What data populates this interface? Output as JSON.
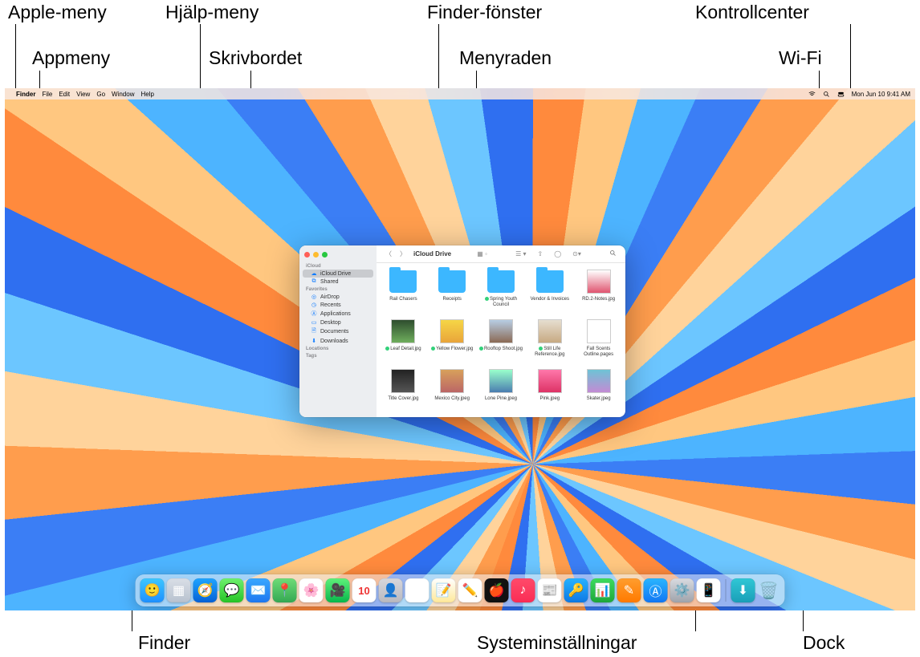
{
  "callouts": {
    "apple_menu": "Apple-meny",
    "app_menu": "Appmeny",
    "help_menu": "Hjälp-meny",
    "desktop": "Skrivbordet",
    "finder_window": "Finder-fönster",
    "menubar": "Menyraden",
    "control_center": "Kontrollcenter",
    "wifi": "Wi-Fi",
    "finder": "Finder",
    "system_settings": "Systeminställningar",
    "dock": "Dock"
  },
  "menubar": {
    "app_name": "Finder",
    "items": [
      "File",
      "Edit",
      "View",
      "Go",
      "Window",
      "Help"
    ],
    "clock": "Mon Jun 10  9:41 AM"
  },
  "finder": {
    "title": "iCloud Drive",
    "sidebar": {
      "sections": [
        {
          "label": "iCloud",
          "items": [
            {
              "icon": "cloud",
              "label": "iCloud Drive",
              "selected": true
            },
            {
              "icon": "shared",
              "label": "Shared"
            }
          ]
        },
        {
          "label": "Favorites",
          "items": [
            {
              "icon": "airdrop",
              "label": "AirDrop"
            },
            {
              "icon": "clock",
              "label": "Recents"
            },
            {
              "icon": "apps",
              "label": "Applications"
            },
            {
              "icon": "desktop",
              "label": "Desktop"
            },
            {
              "icon": "doc",
              "label": "Documents"
            },
            {
              "icon": "download",
              "label": "Downloads"
            }
          ]
        },
        {
          "label": "Locations",
          "items": []
        },
        {
          "label": "Tags",
          "items": []
        }
      ]
    },
    "files": [
      {
        "type": "folder",
        "label": "Rail Chasers"
      },
      {
        "type": "folder",
        "label": "Receipts"
      },
      {
        "type": "folder",
        "label": "Spring Youth Council",
        "tag": true
      },
      {
        "type": "folder",
        "label": "Vendor & Invoices"
      },
      {
        "type": "image",
        "label": "RD.2-Notes.jpg",
        "bg": "linear-gradient(#fff,#e05570)"
      },
      {
        "type": "image",
        "label": "Leaf Detail.jpg",
        "tag": true,
        "bg": "linear-gradient(#2e4d2e,#6fae5d)"
      },
      {
        "type": "image",
        "label": "Yellow Flower.jpg",
        "tag": true,
        "bg": "linear-gradient(#f6d646,#e9a43a)"
      },
      {
        "type": "image",
        "label": "Rooftop Shoot.jpg",
        "tag": true,
        "bg": "linear-gradient(#b7cde4,#8b6a55)"
      },
      {
        "type": "image",
        "label": "Still Life Reference.jpg",
        "tag": true,
        "bg": "linear-gradient(#e6ded0,#c7a982)"
      },
      {
        "type": "image",
        "label": "Fall Scents Outline.pages",
        "bg": "#ffffff"
      },
      {
        "type": "image",
        "label": "Title Cover.jpg",
        "bg": "linear-gradient(#222,#555)"
      },
      {
        "type": "image",
        "label": "Mexico City.jpeg",
        "bg": "linear-gradient(#d8a05b,#b66)"
      },
      {
        "type": "image",
        "label": "Lone Pine.jpeg",
        "bg": "linear-gradient(#9fc,#4a7db0)"
      },
      {
        "type": "image",
        "label": "Pink.jpeg",
        "bg": "linear-gradient(#f7a,#d36)"
      },
      {
        "type": "image",
        "label": "Skater.jpeg",
        "bg": "linear-gradient(#6ec3d5,#c38bd4)"
      }
    ]
  },
  "dock": {
    "items": [
      {
        "name": "finder",
        "bg": "linear-gradient(#3ec7ff,#1e90ff)",
        "glyph": "🙂"
      },
      {
        "name": "launchpad",
        "bg": "linear-gradient(#d9dee6,#b8c2cf)",
        "glyph": "▦"
      },
      {
        "name": "safari",
        "bg": "linear-gradient(#1fa4ff,#0561d6)",
        "glyph": "🧭"
      },
      {
        "name": "messages",
        "bg": "linear-gradient(#6ef06e,#27c427)",
        "glyph": "💬"
      },
      {
        "name": "mail",
        "bg": "linear-gradient(#39a7ff,#1e78f0)",
        "glyph": "✉️"
      },
      {
        "name": "maps",
        "bg": "linear-gradient(#6fdc77,#34a853)",
        "glyph": "📍"
      },
      {
        "name": "photos",
        "bg": "#ffffff",
        "glyph": "🌸"
      },
      {
        "name": "facetime",
        "bg": "linear-gradient(#5ef07a,#08b84c)",
        "glyph": "🎥"
      },
      {
        "name": "calendar",
        "bg": "#ffffff",
        "glyph": "10"
      },
      {
        "name": "contacts",
        "bg": "linear-gradient(#d7d7dc,#b9b9bf)",
        "glyph": "👤"
      },
      {
        "name": "reminders",
        "bg": "#ffffff",
        "glyph": "☰"
      },
      {
        "name": "notes",
        "bg": "linear-gradient(#fff,#ffe999)",
        "glyph": "📝"
      },
      {
        "name": "freeform",
        "bg": "#ffffff",
        "glyph": "✏️"
      },
      {
        "name": "tv",
        "bg": "#111",
        "glyph": "🍎"
      },
      {
        "name": "music",
        "bg": "linear-gradient(#ff4a6a,#fa2d55)",
        "glyph": "♪"
      },
      {
        "name": "news",
        "bg": "#ffffff",
        "glyph": "📰"
      },
      {
        "name": "passwords",
        "bg": "linear-gradient(#27b2ff,#0d78e4)",
        "glyph": "🔑"
      },
      {
        "name": "numbers",
        "bg": "linear-gradient(#3ddc5e,#1fa73a)",
        "glyph": "📊"
      },
      {
        "name": "pages",
        "bg": "linear-gradient(#ff9d2e,#ff7a00)",
        "glyph": "✎"
      },
      {
        "name": "appstore",
        "bg": "linear-gradient(#2ab5ff,#1177f3)",
        "glyph": "Ⓐ"
      },
      {
        "name": "system-settings",
        "bg": "linear-gradient(#d9dbe0,#9fa3ab)",
        "glyph": "⚙️"
      },
      {
        "name": "iphone-mirroring",
        "bg": "#ffffff",
        "glyph": "📱"
      }
    ],
    "right_items": [
      {
        "name": "downloads",
        "bg": "linear-gradient(#30c7d6,#1a9fb8)",
        "glyph": "⬇"
      }
    ]
  }
}
